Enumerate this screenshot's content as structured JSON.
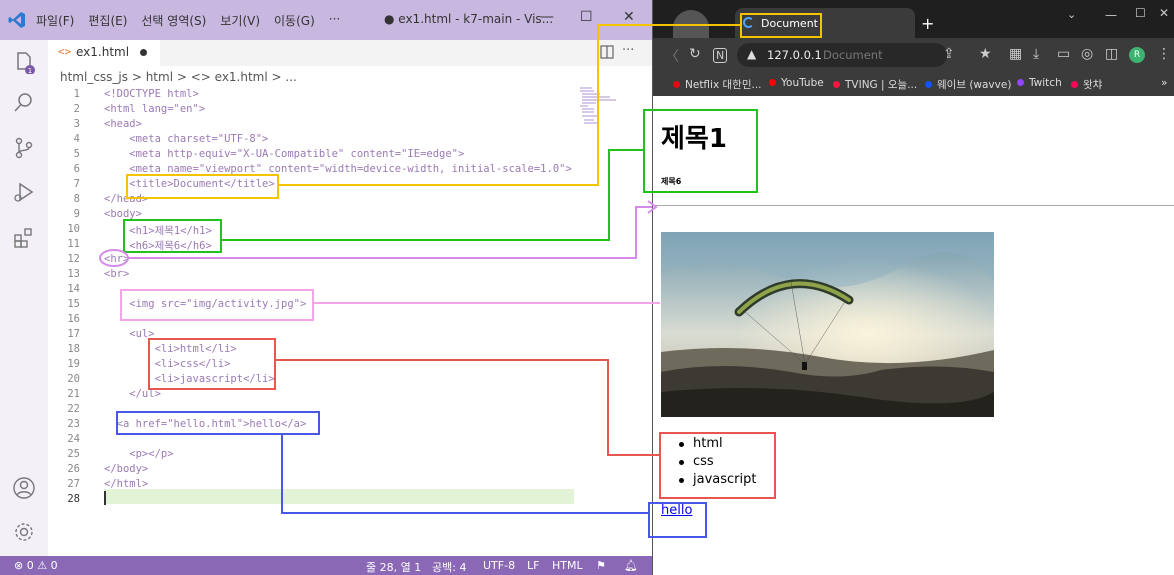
{
  "vscode": {
    "menu": [
      "파일(F)",
      "편집(E)",
      "선택 영역(S)",
      "보기(V)",
      "이동(G)",
      "···"
    ],
    "window_title": "● ex1.html - k7-main - Vis...",
    "tab": {
      "icon": "<>",
      "name": "ex1.html"
    },
    "breadcrumb": "html_css_js > html > <> ex1.html > ...",
    "notification_badge": "1",
    "lines": [
      "1",
      "2",
      "3",
      "4",
      "5",
      "6",
      "7",
      "8",
      "9",
      "10",
      "11",
      "12",
      "13",
      "14",
      "15",
      "16",
      "17",
      "18",
      "19",
      "20",
      "21",
      "22",
      "23",
      "24",
      "25",
      "26",
      "27",
      "28"
    ],
    "code": {
      "l1": "<!DOCTYPE html>",
      "l2": "<html lang=\"en\">",
      "l3": "<head>",
      "l4": "    <meta charset=\"UTF-8\">",
      "l5": "    <meta http-equiv=\"X-UA-Compatible\" content=\"IE=edge\">",
      "l6": "    <meta name=\"viewport\" content=\"width=device-width, initial-scale=1.0\">",
      "l7": "    <title>Document</title>",
      "l8": "</head>",
      "l9": "<body>",
      "l10": "    <h1>제목1</h1>",
      "l11": "    <h6>제목6</h6>",
      "l12": "<hr>",
      "l13": "<br>",
      "l15": "    <img src=\"img/activity.jpg\">",
      "l17": "    <ul>",
      "l18": "        <li>html</li>",
      "l19": "        <li>css</li>",
      "l20": "        <li>javascript</li>",
      "l21": "    </ul>",
      "l23": "  <a href=\"hello.html\">hello</a>",
      "l25": "    <p></p>",
      "l26": "</body>",
      "l27": "</html>"
    },
    "status": {
      "problems": "⊗ 0 ⚠ 0",
      "position": "줄 28, 열 1",
      "spaces": "공백: 4",
      "encoding": "UTF-8",
      "eol": "LF",
      "language": "HTML"
    }
  },
  "browser": {
    "tab_title": "Document",
    "url": "127.0.0.1",
    "omnibox_title": "Document",
    "bookmarks": [
      {
        "label": "Netflix 대한민...",
        "color": "#e50914"
      },
      {
        "label": "YouTube",
        "color": "#ff0000"
      },
      {
        "label": "TVING | 오늘...",
        "color": "#ff153c"
      },
      {
        "label": "웨이브 (wavve)",
        "color": "#1351f9"
      },
      {
        "label": "Twitch",
        "color": "#9146ff"
      },
      {
        "label": "왓챠",
        "color": "#ff0558"
      }
    ],
    "profile_initial": "R",
    "page": {
      "h1": "제목1",
      "h6": "제목6",
      "list": [
        "html",
        "css",
        "javascript"
      ],
      "link": "hello"
    }
  },
  "colors": {
    "yellow": "#f5c400",
    "green": "#21c21c",
    "purple": "#d58ce8",
    "pink": "#f4a6e4",
    "red": "#e8574f",
    "blue": "#4a56e8"
  }
}
